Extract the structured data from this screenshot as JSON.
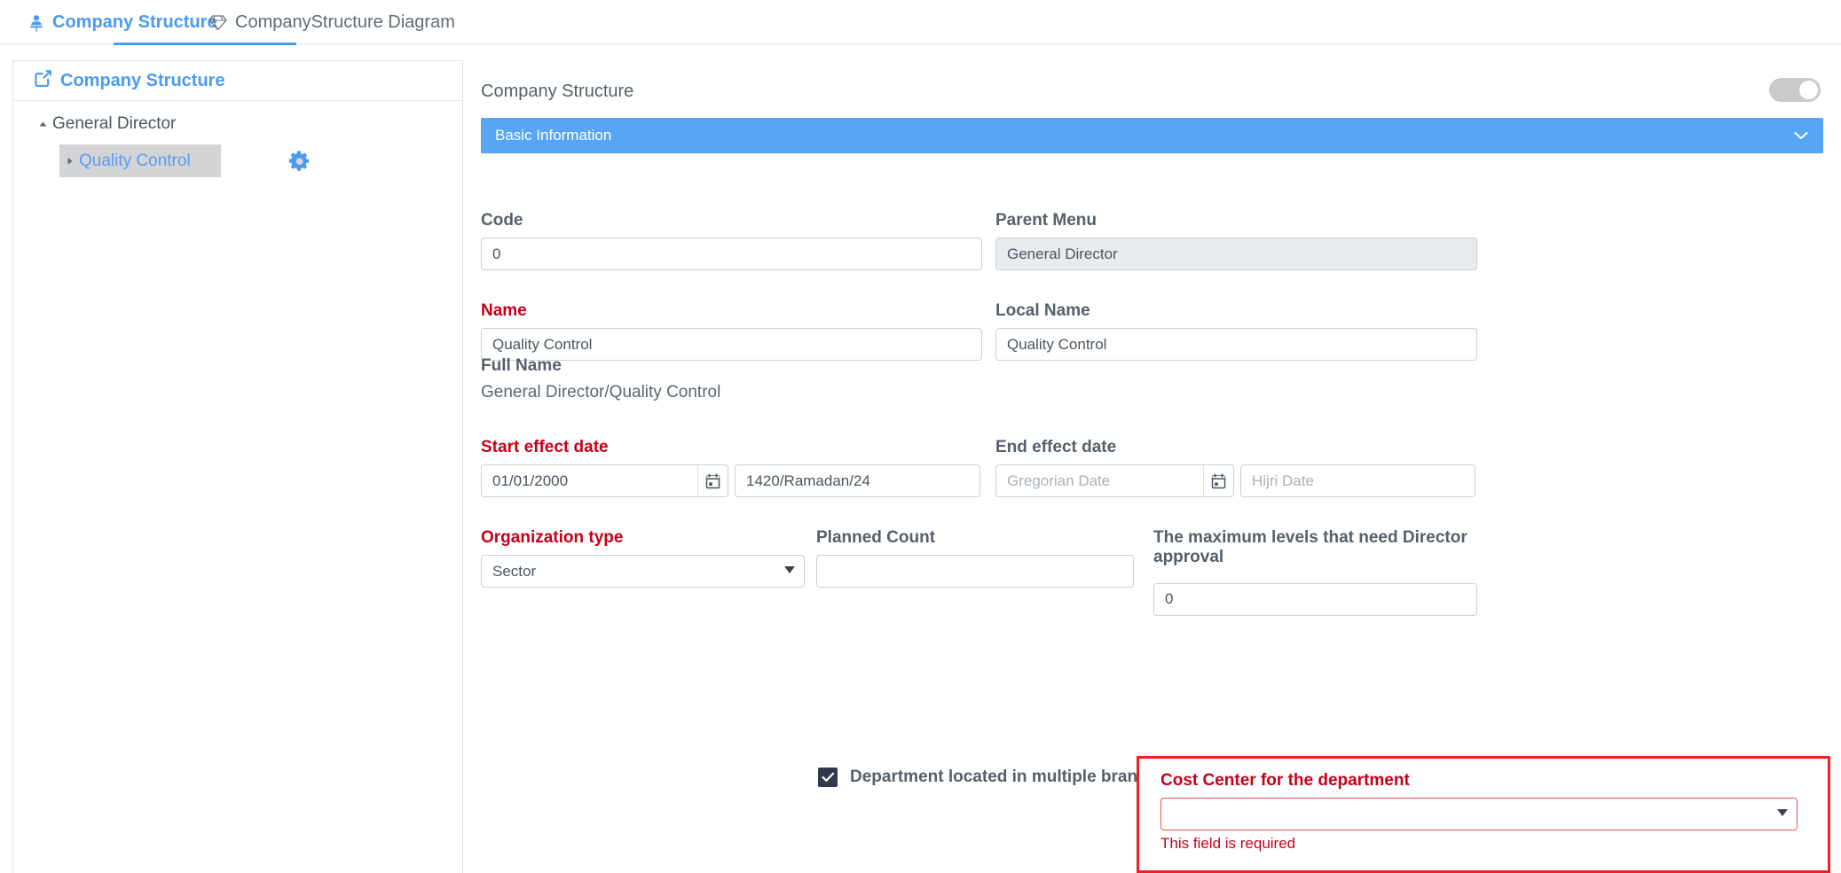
{
  "tabs": [
    {
      "label": "Company Structure",
      "icon": "person-pin-icon",
      "active": true
    },
    {
      "label": "CompanyStructure Diagram",
      "icon": "diamond-icon",
      "active": false
    }
  ],
  "sidebar": {
    "title": "Company Structure",
    "title_icon": "external-link-icon",
    "tree": [
      {
        "label": "General Director",
        "caret": "▲",
        "level": 1,
        "expanded": true,
        "selected": false
      },
      {
        "label": "Quality Control",
        "caret": "►",
        "level": 2,
        "expanded": false,
        "selected": true,
        "action_icon": "gear-icon"
      }
    ]
  },
  "main": {
    "title": "Company Structure",
    "toggle": {
      "name": "status-toggle",
      "on": false
    },
    "section": {
      "label": "Basic Information",
      "chevron": "chevron-down-icon",
      "expanded": true
    },
    "fields": {
      "code": {
        "label": "Code",
        "value": "0",
        "required": false
      },
      "parent_menu": {
        "label": "Parent Menu",
        "value": "General Director",
        "required": false,
        "readonly": true
      },
      "name": {
        "label": "Name",
        "value": "Quality Control",
        "required": true
      },
      "local_name": {
        "label": "Local Name",
        "value": "Quality Control",
        "required": false
      },
      "full_name": {
        "label": "Full Name",
        "value": "General Director/Quality Control"
      },
      "start_effect_date": {
        "label": "Start effect date",
        "required": true,
        "gregorian_value": "01/01/2000",
        "gregorian_placeholder": "Gregorian Date",
        "hijri_value": "1420/Ramadan/24",
        "hijri_placeholder": "Hijri Date",
        "calendar_icon": "calendar-icon"
      },
      "end_effect_date": {
        "label": "End effect date",
        "required": false,
        "gregorian_value": "",
        "gregorian_placeholder": "Gregorian Date",
        "hijri_value": "",
        "hijri_placeholder": "Hijri Date",
        "calendar_icon": "calendar-icon"
      },
      "organization_type": {
        "label": "Organization type",
        "required": true,
        "value": "Sector",
        "options": [
          "Sector"
        ]
      },
      "planned_count": {
        "label": "Planned Count",
        "value": "",
        "required": false
      },
      "max_levels": {
        "label": "The maximum levels that need Director approval",
        "value": "0",
        "required": false
      },
      "multi_branch": {
        "label": "Department located in multiple branches",
        "checked": true,
        "check_glyph": "✔"
      },
      "cost_center": {
        "label": "Cost Center for the department",
        "required": true,
        "value": "",
        "options": [],
        "error": "This field is required"
      }
    }
  },
  "colors": {
    "accent_blue": "#4a9bf0",
    "section_blue": "#57a5f5",
    "required_red": "#c7001a",
    "error_border_red": "#ee2222",
    "checkbox_navy": "#2e3b4e"
  }
}
